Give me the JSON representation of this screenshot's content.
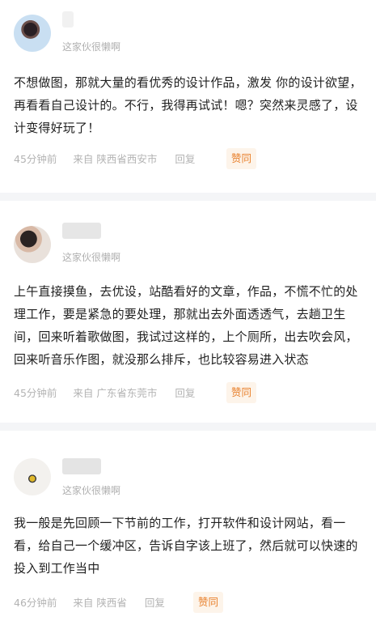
{
  "posts": [
    {
      "signature": "这家伙很懒啊",
      "content": "不想做图，那就大量的看优秀的设计作品，激发 你的设计欲望，再看看自己设计的。不行，我得再试试！嗯？突然来灵感了，设计变得好玩了！",
      "time": "45分钟前",
      "location": "来自 陕西省西安市",
      "reply_label": "回复",
      "like_label": "赞同"
    },
    {
      "signature": "这家伙很懒啊",
      "content": "上午直接摸鱼，去优设，站酷看好的文章，作品，不慌不忙的处理工作，要是紧急的要处理，那就出去外面透透气，去趟卫生间，回来听着歌做图，我试过这样的，上个厕所，出去吹会风，回来听音乐作图，就没那么排斥，也比较容易进入状态",
      "time": "45分钟前",
      "location": "来自 广东省东莞市",
      "reply_label": "回复",
      "like_label": "赞同"
    },
    {
      "signature": "这家伙很懒啊",
      "content": "我一般是先回顾一下节前的工作，打开软件和设计网站，看一看，给自己一个缓冲区，告诉自字该上班了，然后就可以快速的投入到工作当中",
      "time": "46分钟前",
      "location": "来自 陕西省",
      "reply_label": "回复",
      "like_label": "赞同"
    }
  ]
}
